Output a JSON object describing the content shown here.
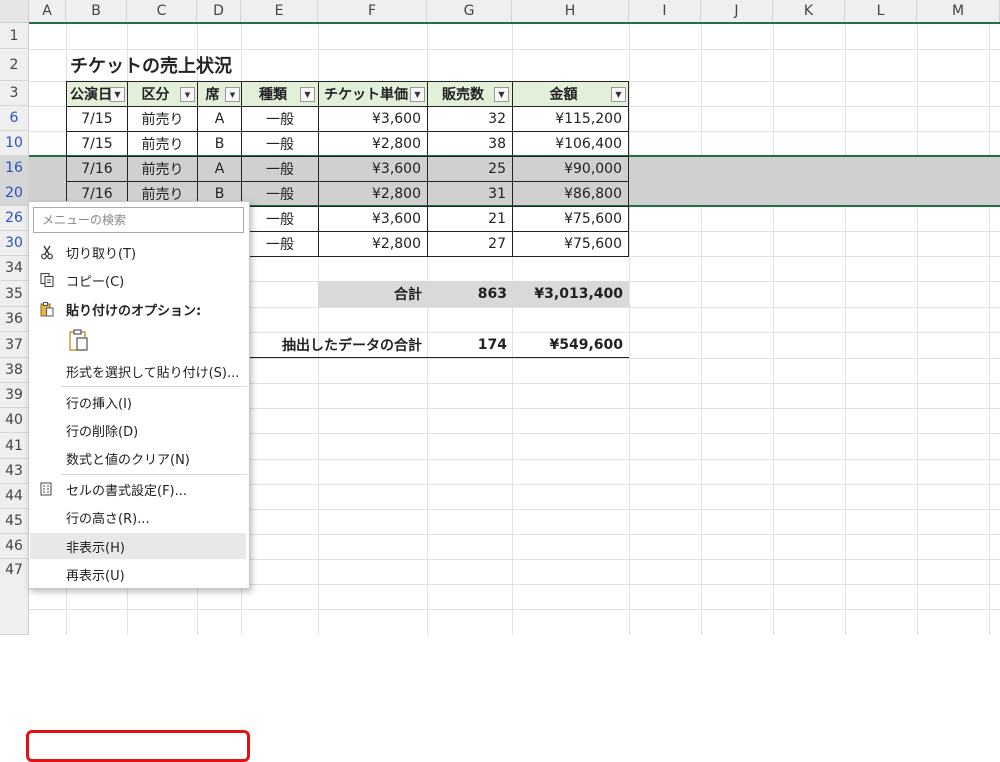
{
  "columns": [
    "A",
    "B",
    "C",
    "D",
    "E",
    "F",
    "G",
    "H",
    "I",
    "J",
    "K",
    "L",
    "M"
  ],
  "rows": [
    "1",
    "2",
    "3",
    "6",
    "10",
    "16",
    "20",
    "26",
    "30",
    "34",
    "35",
    "36",
    "37",
    "38",
    "39",
    "40",
    "41",
    "43",
    "44",
    "45",
    "46",
    "47"
  ],
  "title": "チケットの売上状況",
  "table": {
    "headers": [
      "公演日",
      "区分",
      "席",
      "種類",
      "チケット単価",
      "販売数",
      "金額"
    ],
    "rows": [
      [
        "7/15",
        "前売り",
        "A",
        "一般",
        "¥3,600",
        "32",
        "¥115,200"
      ],
      [
        "7/15",
        "前売り",
        "B",
        "一般",
        "¥2,800",
        "38",
        "¥106,400"
      ],
      [
        "7/16",
        "前売り",
        "A",
        "一般",
        "¥3,600",
        "25",
        "¥90,000"
      ],
      [
        "7/16",
        "前売り",
        "B",
        "一般",
        "¥2,800",
        "31",
        "¥86,800"
      ],
      [
        "",
        "",
        "",
        "一般",
        "¥3,600",
        "21",
        "¥75,600"
      ],
      [
        "",
        "",
        "",
        "一般",
        "¥2,800",
        "27",
        "¥75,600"
      ]
    ]
  },
  "total": {
    "label": "合計",
    "count": "863",
    "amount": "¥3,013,400"
  },
  "extracted_total": {
    "label": "抽出したデータの合計",
    "count": "174",
    "amount": "¥549,600"
  },
  "context_menu": {
    "search_placeholder": "メニューの検索",
    "cut": "切り取り(T)",
    "copy": "コピー(C)",
    "paste_options": "貼り付けのオプション:",
    "paste_special": "形式を選択して貼り付け(S)...",
    "insert_rows": "行の挿入(I)",
    "delete_rows": "行の削除(D)",
    "clear_contents": "数式と値のクリア(N)",
    "format_cells": "セルの書式設定(F)...",
    "row_height": "行の高さ(R)...",
    "hide": "非表示(H)",
    "unhide": "再表示(U)"
  },
  "colors": {
    "accent": "#1e7145",
    "highlight": "#e31111",
    "header_fill": "#e2efd9"
  }
}
